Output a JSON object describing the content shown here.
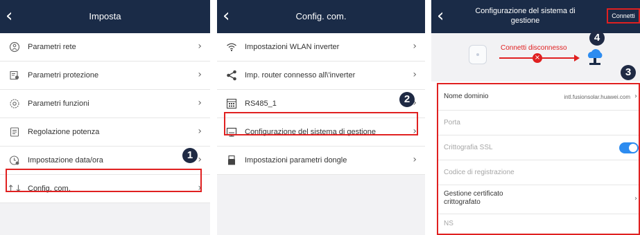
{
  "screen1": {
    "title": "Imposta",
    "items": [
      {
        "label": "Parametri rete",
        "icon": "network-icon"
      },
      {
        "label": "Parametri protezione",
        "icon": "protection-icon"
      },
      {
        "label": "Parametri funzioni",
        "icon": "function-icon"
      },
      {
        "label": "Regolazione potenza",
        "icon": "power-adjust-icon"
      },
      {
        "label": "Impostazione data/ora",
        "icon": "clock-icon"
      },
      {
        "label": "Config. com.",
        "icon": "communication-icon"
      }
    ],
    "step_badge": "1"
  },
  "screen2": {
    "title": "Config. com.",
    "items": [
      {
        "label": "Impostazioni WLAN inverter",
        "icon": "wifi-icon"
      },
      {
        "label": "Imp. router connesso all\\'inverter",
        "icon": "share-icon"
      },
      {
        "label": "RS485_1",
        "icon": "rs485-icon"
      },
      {
        "label": "Configurazione del sistema di gestione",
        "icon": "monitor-icon"
      },
      {
        "label": "Impostazioni parametri dongle",
        "icon": "dongle-icon"
      }
    ],
    "step_badge": "2"
  },
  "screen3": {
    "title_line1": "Configurazione del sistema di",
    "title_line2": "gestione",
    "connect_label": "Connetti",
    "status_text": "Connetti disconnesso",
    "fields": [
      {
        "label": "Nome dominio",
        "value": "intl.fusionsolar.huawei.com"
      },
      {
        "label": "Porta",
        "value": ""
      },
      {
        "label": "Crittografia SSL",
        "value": "",
        "toggle": true
      },
      {
        "label": "Codice di registrazione",
        "value": ""
      },
      {
        "label": "Gestione certificato crittografato",
        "value": ""
      },
      {
        "label": "NS",
        "value": ""
      }
    ],
    "step_badges": [
      "3",
      "4"
    ]
  },
  "colors": {
    "header": "#1a2b47",
    "highlight": "#e02020",
    "badge": "#1f2a44",
    "toggle": "#2d8cf0",
    "filler": "#f2f2f4"
  }
}
